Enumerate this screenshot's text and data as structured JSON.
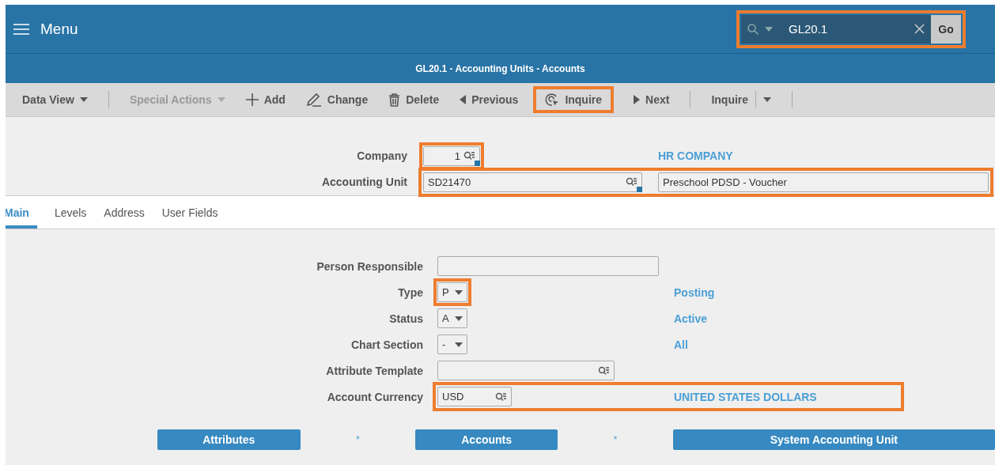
{
  "header": {
    "menu_label": "Menu",
    "search": {
      "value": "GL20.1",
      "go": "Go",
      "highlighted": true
    }
  },
  "title": "GL20.1 - Accounting Units - Accounts",
  "toolbar": [
    {
      "kind": "menu",
      "label": "Data View",
      "disabled": false,
      "highlighted": false
    },
    {
      "kind": "separator"
    },
    {
      "kind": "menu",
      "label": "Special Actions",
      "disabled": true,
      "highlighted": false
    },
    {
      "kind": "add",
      "label": "Add",
      "disabled": false,
      "highlighted": false
    },
    {
      "kind": "change",
      "label": "Change",
      "disabled": false,
      "highlighted": false
    },
    {
      "kind": "delete",
      "label": "Delete",
      "disabled": false,
      "highlighted": false
    },
    {
      "kind": "previous",
      "label": "Previous",
      "disabled": false,
      "highlighted": false
    },
    {
      "kind": "inquire",
      "label": "Inquire",
      "disabled": false,
      "highlighted": true
    },
    {
      "kind": "next",
      "label": "Next",
      "disabled": false,
      "highlighted": false
    },
    {
      "kind": "separator"
    },
    {
      "kind": "split",
      "label": "Inquire",
      "disabled": false,
      "highlighted": false
    },
    {
      "kind": "separator"
    }
  ],
  "key_fields": [
    {
      "label": "Company",
      "kind": "short",
      "value": "1",
      "description": "HR COMPANY",
      "description_boxed": false,
      "field_highlighted": true,
      "row_highlighted": false
    },
    {
      "label": "Accounting Unit",
      "kind": "wide",
      "value": "SD21470",
      "description": "Preschool PDSD - Voucher",
      "description_boxed": true,
      "field_highlighted": false,
      "row_highlighted": true
    }
  ],
  "tabs": [
    {
      "label": "Main",
      "selected": true
    },
    {
      "label": "Levels",
      "selected": false
    },
    {
      "label": "Address",
      "selected": false
    },
    {
      "label": "User Fields",
      "selected": false
    }
  ],
  "fields": [
    {
      "label": "Person Responsible",
      "kind": "text",
      "field_highlighted": false,
      "row_highlighted": false
    },
    {
      "label": "Type",
      "kind": "select",
      "value": "P",
      "description": "Posting",
      "field_highlighted": true,
      "row_highlighted": false
    },
    {
      "label": "Status",
      "kind": "select",
      "value": "A",
      "description": "Active",
      "field_highlighted": false,
      "row_highlighted": false
    },
    {
      "label": "Chart Section",
      "kind": "select",
      "value": "-",
      "description": "All",
      "field_highlighted": false,
      "row_highlighted": false
    },
    {
      "label": "Attribute Template",
      "kind": "lookup",
      "field_highlighted": false,
      "row_highlighted": false
    },
    {
      "label": "Account Currency",
      "kind": "lookup_short",
      "value": "USD",
      "description": "UNITED STATES DOLLARS",
      "field_highlighted": false,
      "row_highlighted": true
    }
  ],
  "actions": [
    {
      "kind": "button",
      "label": "Attributes"
    },
    {
      "kind": "marker",
      "label": "*"
    },
    {
      "kind": "button",
      "label": "Accounts"
    },
    {
      "kind": "marker",
      "label": "*"
    },
    {
      "kind": "wide_button",
      "label": "System Accounting Unit"
    }
  ]
}
